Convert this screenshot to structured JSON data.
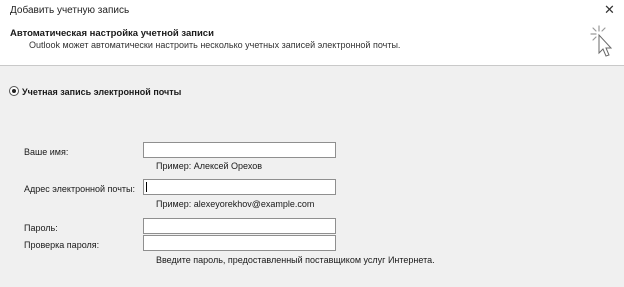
{
  "window": {
    "title": "Добавить учетную запись",
    "close_glyph": "✕"
  },
  "header": {
    "title": "Автоматическая настройка учетной записи",
    "description": "Outlook может автоматически настроить несколько учетных записей электронной почты.",
    "icon": "wizard-cursor-icon"
  },
  "account_type": {
    "label": "Учетная запись электронной почты",
    "selected": true
  },
  "form": {
    "name": {
      "label": "Ваше имя:",
      "value": "",
      "hint": "Пример: Алексей Орехов"
    },
    "email": {
      "label": "Адрес электронной почты:",
      "value": "",
      "hint": "Пример: alexeyorekhov@example.com"
    },
    "password": {
      "label": "Пароль:",
      "value": ""
    },
    "password_confirm": {
      "label": "Проверка пароля:",
      "value": "",
      "hint": "Введите пароль, предоставленный поставщиком услуг Интернета."
    }
  }
}
